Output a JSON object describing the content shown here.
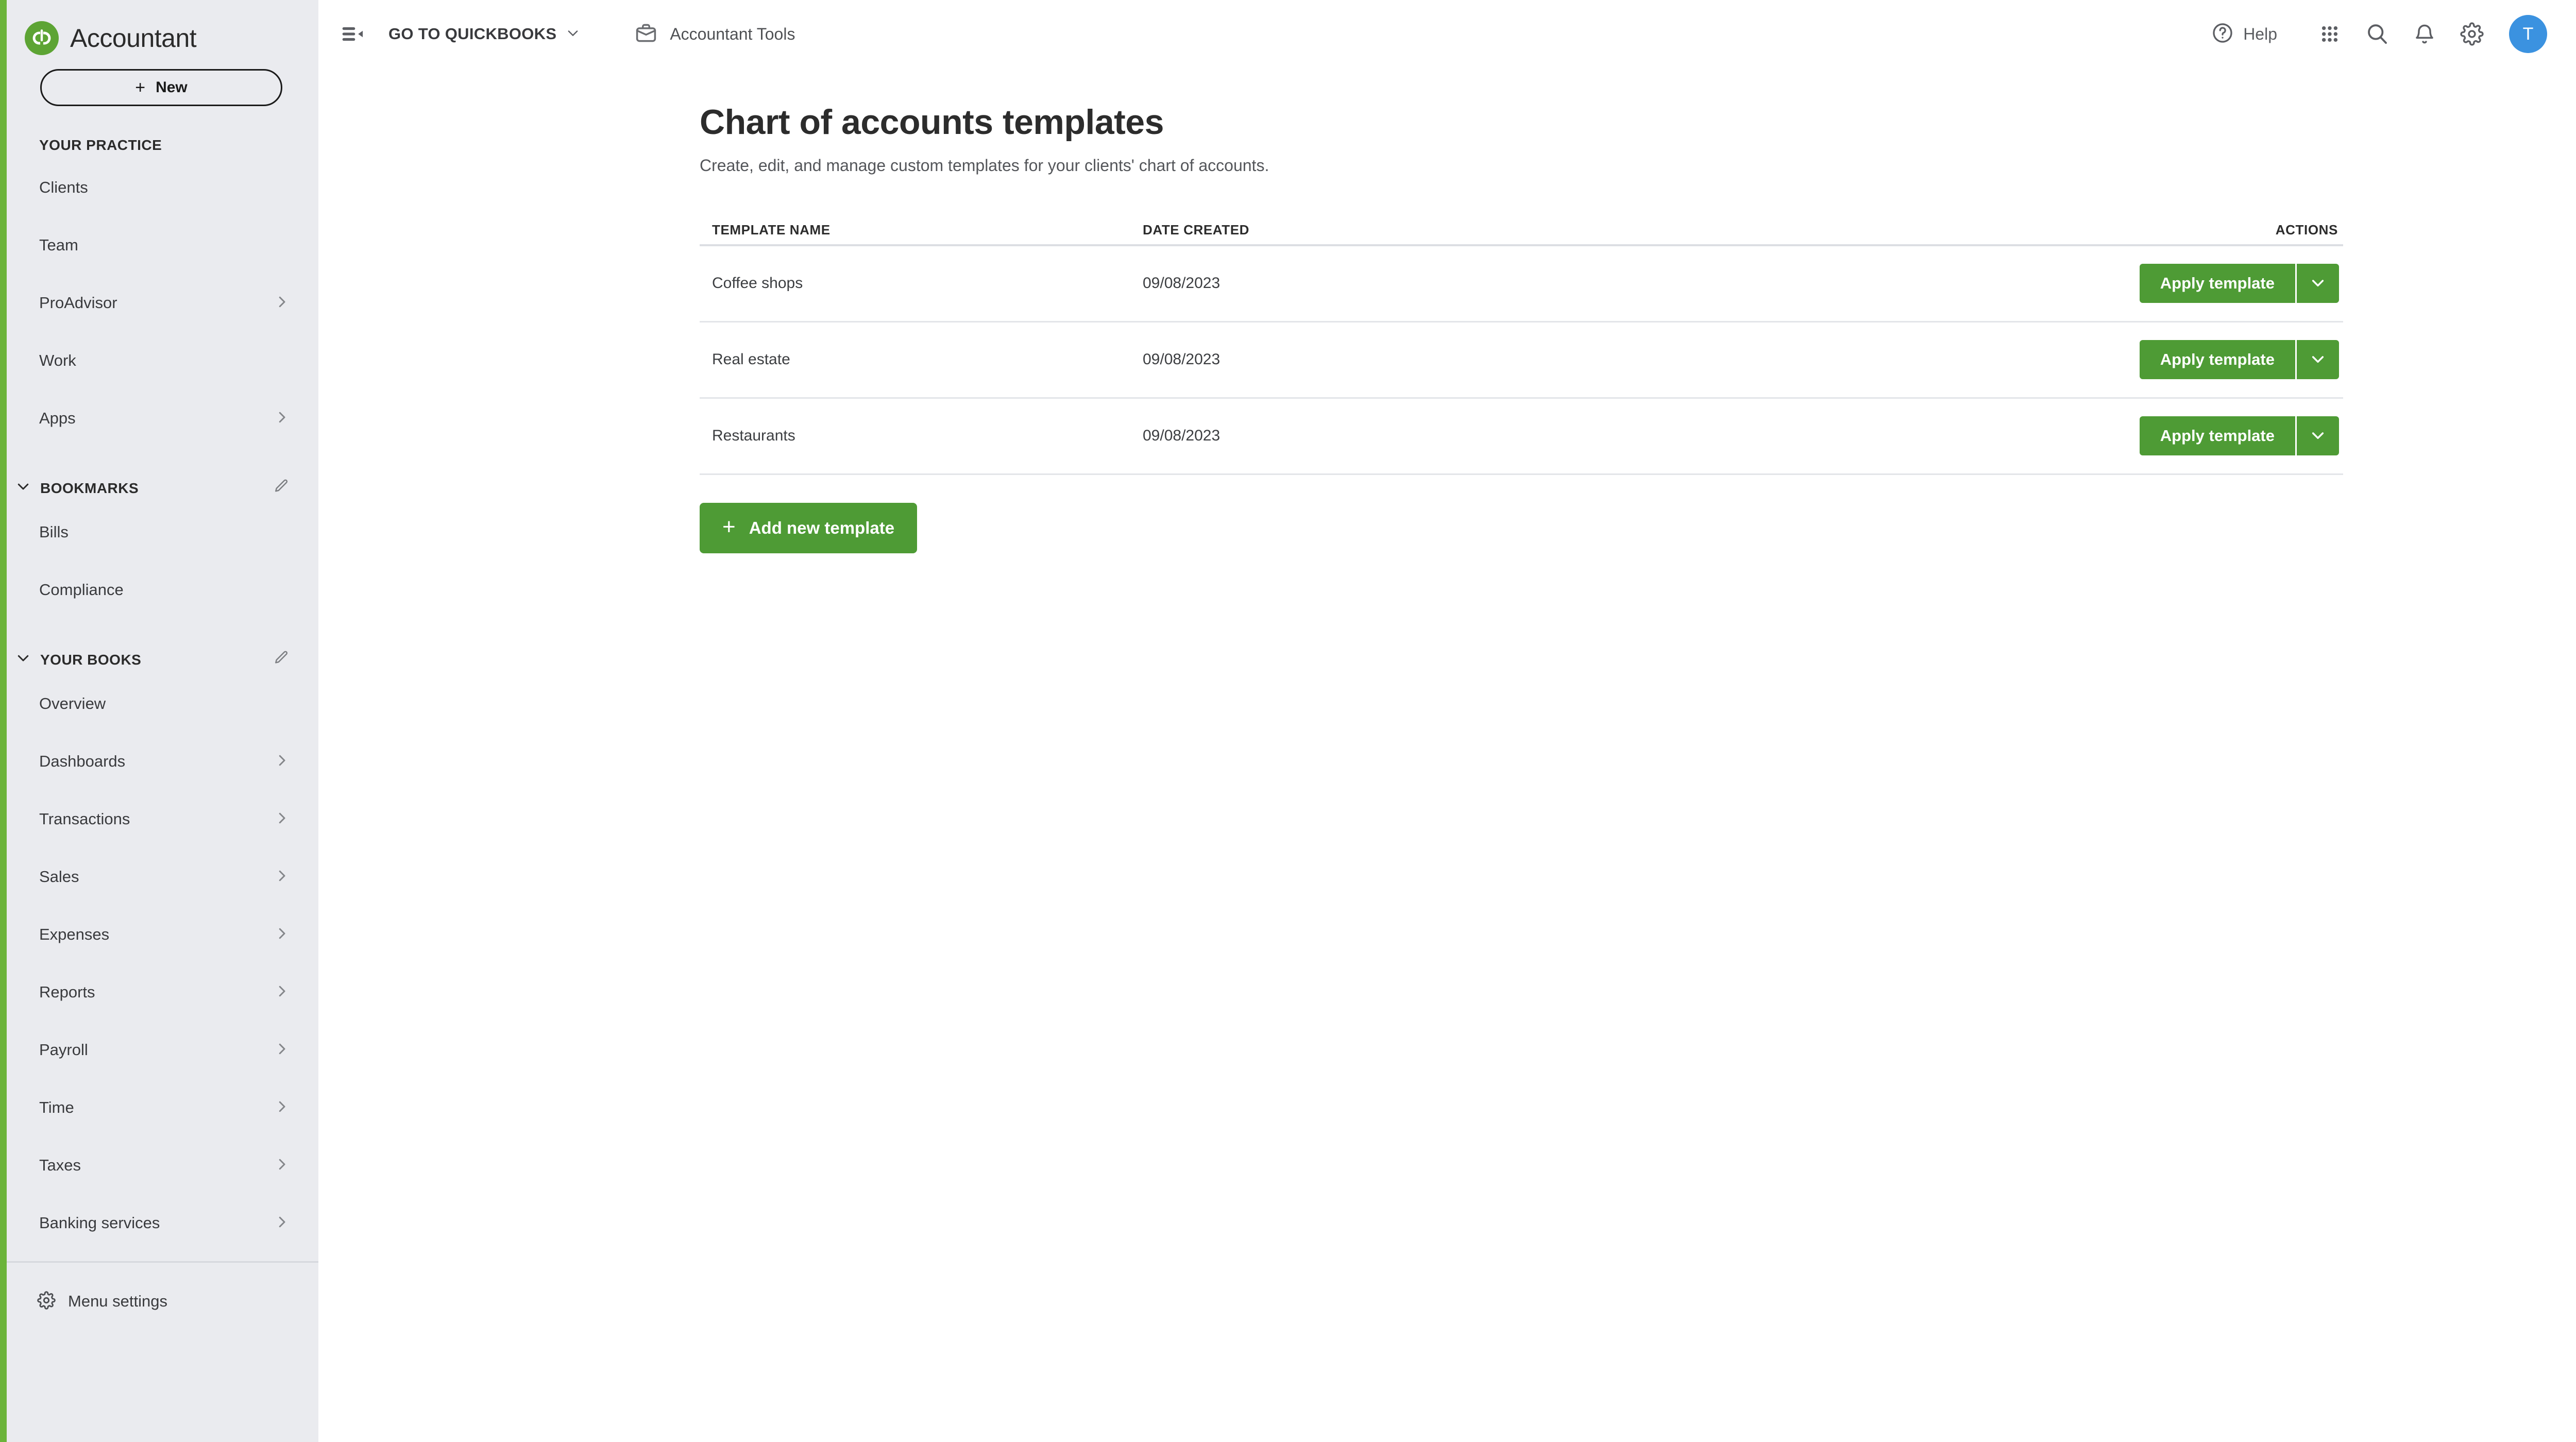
{
  "brand": {
    "name": "Accountant",
    "logo_icon": "quickbooks-logo-icon"
  },
  "sidebar": {
    "new_button": {
      "label": "New",
      "icon": "plus-icon"
    },
    "sections": [
      {
        "label": "YOUR PRACTICE",
        "collapsible": false,
        "has_edit": false,
        "items": [
          {
            "label": "Clients",
            "chevron": false
          },
          {
            "label": "Team",
            "chevron": false
          },
          {
            "label": "ProAdvisor",
            "chevron": true
          },
          {
            "label": "Work",
            "chevron": false
          },
          {
            "label": "Apps",
            "chevron": true
          }
        ]
      },
      {
        "label": "BOOKMARKS",
        "collapsible": true,
        "has_edit": true,
        "edit_icon": "pencil-icon",
        "items": [
          {
            "label": "Bills",
            "chevron": false
          },
          {
            "label": "Compliance",
            "chevron": false
          }
        ]
      },
      {
        "label": "YOUR BOOKS",
        "collapsible": true,
        "has_edit": true,
        "edit_icon": "pencil-icon",
        "items": [
          {
            "label": "Overview",
            "chevron": false
          },
          {
            "label": "Dashboards",
            "chevron": true
          },
          {
            "label": "Transactions",
            "chevron": true
          },
          {
            "label": "Sales",
            "chevron": true
          },
          {
            "label": "Expenses",
            "chevron": true
          },
          {
            "label": "Reports",
            "chevron": true
          },
          {
            "label": "Payroll",
            "chevron": true
          },
          {
            "label": "Time",
            "chevron": true
          },
          {
            "label": "Taxes",
            "chevron": true
          },
          {
            "label": "Banking services",
            "chevron": true
          }
        ]
      }
    ],
    "menu_settings": {
      "label": "Menu settings",
      "icon": "gear-icon"
    },
    "accent_color": "#6bb43a",
    "background_color": "#eaebef"
  },
  "topbar": {
    "collapse_icon": "sidebar-collapse-icon",
    "goto_quickbooks": {
      "label": "GO TO QUICKBOOKS",
      "icon": "chevron-down-icon"
    },
    "accountant_tools": {
      "label": "Accountant Tools",
      "icon": "briefcase-icon"
    },
    "help": {
      "label": "Help",
      "icon": "help-circle-icon"
    },
    "grid_icon": "apps-grid-icon",
    "search_icon": "search-icon",
    "notifications_icon": "bell-icon",
    "settings_icon": "gear-icon",
    "avatar": {
      "initial": "T",
      "color": "#3b92e0"
    }
  },
  "page": {
    "title": "Chart of accounts templates",
    "subtitle": "Create, edit, and manage custom templates for your clients' chart of accounts."
  },
  "table": {
    "columns": [
      "TEMPLATE NAME",
      "DATE CREATED",
      "ACTIONS"
    ],
    "rows": [
      {
        "name": "Coffee shops",
        "date": "09/08/2023",
        "action_label": "Apply template",
        "caret_icon": "chevron-down-icon"
      },
      {
        "name": "Real estate",
        "date": "09/08/2023",
        "action_label": "Apply template",
        "caret_icon": "chevron-down-icon"
      },
      {
        "name": "Restaurants",
        "date": "09/08/2023",
        "action_label": "Apply template",
        "caret_icon": "chevron-down-icon"
      }
    ]
  },
  "add_template_button": {
    "label": "Add new template",
    "icon": "plus-icon",
    "color": "#4e9b35"
  }
}
